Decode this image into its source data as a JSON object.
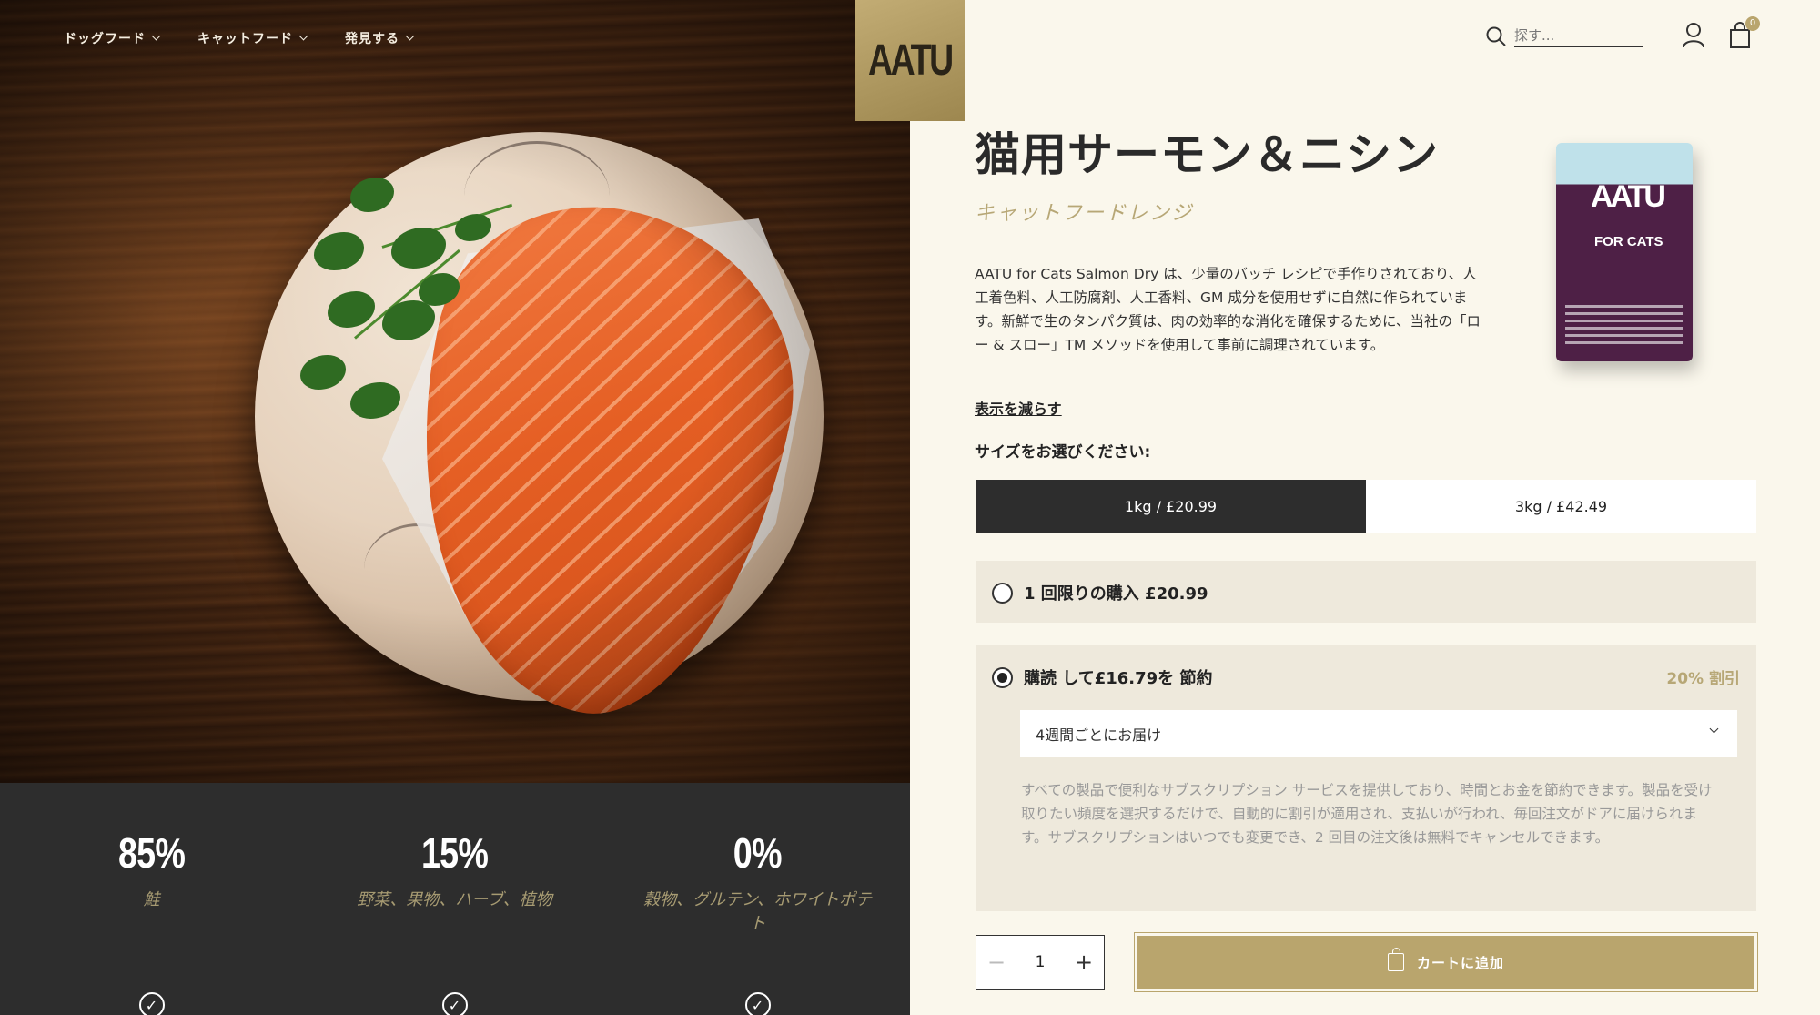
{
  "nav": {
    "items": [
      {
        "label": "ドッグフード"
      },
      {
        "label": "キャットフード"
      },
      {
        "label": "発見する"
      }
    ]
  },
  "logo": {
    "text": "AATU"
  },
  "header": {
    "search_placeholder": "探す...",
    "cart_count": "0"
  },
  "product": {
    "title": "猫用サーモン＆ニシン",
    "subtitle": "キャットフードレンジ",
    "description": "AATU for Cats Salmon Dry は、少量のバッチ レシピで手作りされており、人工着色料、人工防腐剤、人工香料、GM 成分を使用せずに自然に作られています。新鮮で生のタンパク質は、肉の効率的な消化を確保するために、当社の「ロー & スロー」TM メソッドを使用して事前に調理されています。",
    "show_less": "表示を減らす",
    "size_prompt": "サイズをお選びください:",
    "package": {
      "logo": "AATU",
      "sub": "FOR CATS"
    }
  },
  "sizes": [
    {
      "label": "1kg / £20.99",
      "active": true
    },
    {
      "label": "3kg / £42.49",
      "active": false
    }
  ],
  "purchase": {
    "once_label": "1 回限りの購入 £20.99",
    "subscribe_label": "購読 して£16.79を 節約",
    "discount": "20% 割引",
    "frequency": "4週間ごとにお届け",
    "note": "すべての製品で便利なサブスクリプション サービスを提供しており、時間とお金を節約できます。製品を受け取りたい頻度を選択するだけで、自動的に割引が適用され、支払いが行われ、毎回注文がドアに届けられます。サブスクリプションはいつでも変更でき、2 回目の注文後は無料でキャンセルできます。"
  },
  "quantity": {
    "value": "1",
    "minus": "−",
    "plus": "+"
  },
  "add_to_cart": "カートに追加",
  "stats": [
    {
      "value": "85%",
      "label": "鮭"
    },
    {
      "value": "15%",
      "label": "野菜、果物、ハーブ、植物"
    },
    {
      "value": "0%",
      "label": "穀物、グルテン、ホワイトポテト"
    }
  ],
  "colors": {
    "accent_gold": "#b9a56d",
    "dark": "#2d2d2d",
    "cream": "#faf7ec"
  }
}
